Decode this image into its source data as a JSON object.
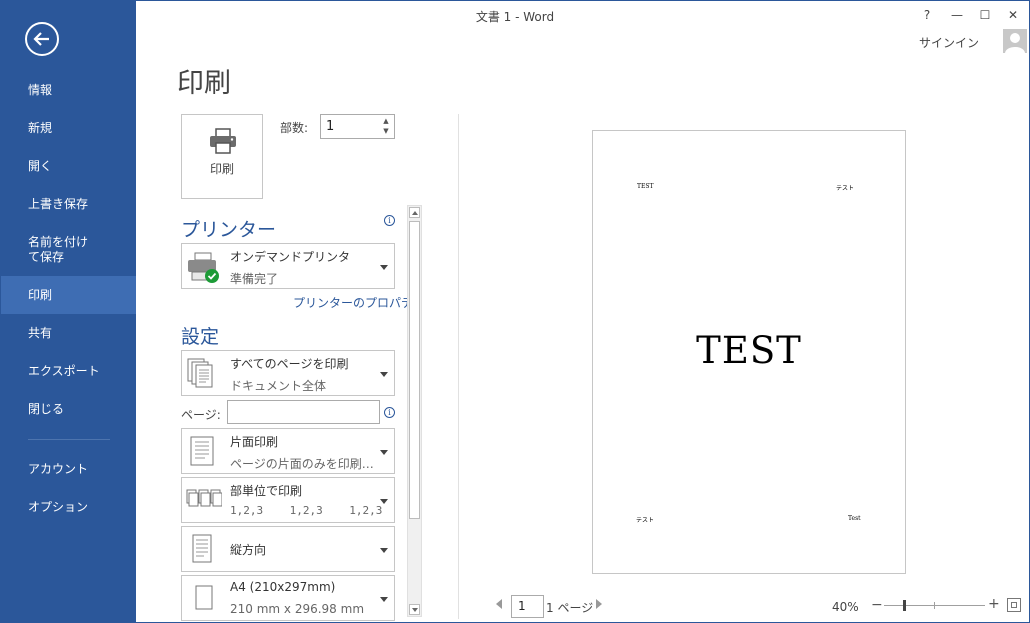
{
  "window": {
    "title": "文書 1 - Word",
    "help": "?",
    "minimize": "—",
    "maximize": "☐",
    "close": "✕",
    "signin": "サインイン"
  },
  "sidebar": {
    "items": [
      {
        "label": "情報"
      },
      {
        "label": "新規"
      },
      {
        "label": "開く"
      },
      {
        "label": "上書き保存"
      },
      {
        "label": "名前を付けて保存"
      },
      {
        "label": "印刷"
      },
      {
        "label": "共有"
      },
      {
        "label": "エクスポート"
      },
      {
        "label": "閉じる"
      },
      {
        "label": "アカウント"
      },
      {
        "label": "オプション"
      }
    ],
    "active": "印刷",
    "bg_color": "#2b579a",
    "active_color": "#3e6db3"
  },
  "main": {
    "title": "印刷",
    "print_button_label": "印刷",
    "copies_label": "部数:",
    "copies_value": "1",
    "printer_section": "プリンター",
    "printer_name": "オンデマンドプリンタ",
    "printer_status": "準備完了",
    "printer_properties": "プリンターのプロパティ",
    "settings_section": "設定",
    "pages_label": "ページ:",
    "pages_value": "",
    "settings": [
      {
        "main": "すべてのページを印刷",
        "sub": "ドキュメント全体"
      },
      {
        "main": "片面印刷",
        "sub": "ページの片面のみを印刷…"
      },
      {
        "main": "部単位で印刷",
        "sub": "1,2,3    1,2,3    1,2,3"
      },
      {
        "main": "縦方向",
        "sub": ""
      },
      {
        "main": "A4 (210x297mm)",
        "sub": "210 mm x 296.98 mm"
      }
    ],
    "info_glyph": "i"
  },
  "preview": {
    "top_left": "TEST",
    "top_right": "テスト",
    "center": "TEST",
    "bottom_left": "テスト",
    "bottom_right": "Test",
    "page_current": "1",
    "page_total": "1 ページ",
    "zoom": "40%",
    "zoom_minus": "−",
    "zoom_plus": "+",
    "zoom_level": 0.2
  }
}
